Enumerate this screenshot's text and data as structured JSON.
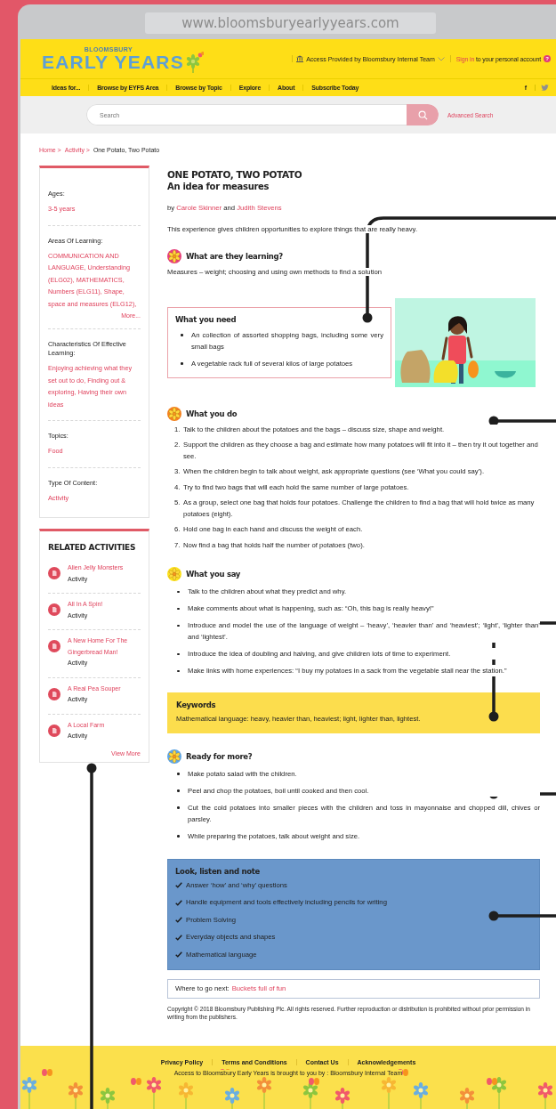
{
  "browser": {
    "url": "www.bloomsburyearlyyears.com"
  },
  "header": {
    "brand_small": "BLOOMSBURY",
    "brand": "EARLY YEARS",
    "access": "Access Provided by Bloomsbury Internal Team",
    "sign_in": "Sign in",
    "sign_in_rest": "to your personal account",
    "help": "?",
    "facebook": "f"
  },
  "nav": [
    "Ideas for...",
    "Browse by EYFS Area",
    "Browse by Topic",
    "Explore",
    "About",
    "Subscribe Today"
  ],
  "search": {
    "placeholder": "Search",
    "advanced": "Advanced Search"
  },
  "breadcrumbs": [
    {
      "label": "Home >",
      "link": true
    },
    {
      "label": "Activity >",
      "link": true
    },
    {
      "label": "One Potato, Two Potato",
      "link": false
    }
  ],
  "sidebar": {
    "facets": [
      {
        "label": "Ages:",
        "values": [
          "3-5 years"
        ]
      },
      {
        "label": "Areas Of Learning:",
        "values": [
          "COMMUNICATION AND LANGUAGE,",
          "Understanding (ELG02),",
          "MATHEMATICS,",
          "Numbers (ELG11),",
          "Shape, space and measures (ELG12),"
        ],
        "more": "More..."
      },
      {
        "label": "Characteristics Of Effective Learning:",
        "values": [
          "Enjoying achieving what they set out to do,",
          "Finding out & exploring,",
          "Having their own ideas"
        ]
      },
      {
        "label": "Topics:",
        "values": [
          "Food"
        ]
      },
      {
        "label": "Type Of Content:",
        "values": [
          "Activity"
        ]
      }
    ]
  },
  "related": {
    "title": "RELATED ACTIVITIES",
    "items": [
      {
        "title": "Alien Jelly Monsters",
        "type": "Activity"
      },
      {
        "title": "All In A Spin!",
        "type": "Activity"
      },
      {
        "title": "A New Home For The Gingerbread Man!",
        "type": "Activity"
      },
      {
        "title": "A Real Pea Souper",
        "type": "Activity"
      },
      {
        "title": "A Local Farm",
        "type": "Activity"
      }
    ],
    "view_more": "View More"
  },
  "article": {
    "title": "ONE POTATO, TWO POTATO",
    "subtitle": "An idea for measures",
    "by": "by",
    "authors": [
      "Carole Skinner",
      "Judith Stevens"
    ],
    "joiner": "and",
    "intro": "This experience gives children opportunities to explore things that are really heavy.",
    "sections": [
      {
        "kind": "text",
        "title": "What are they learning?",
        "color": "#e9407e",
        "text": "Measures – weight; choosing and using own methods to find a solution"
      },
      {
        "kind": "need",
        "title": "What you need",
        "items": [
          "An collection of assorted shopping bags, including some very small bags",
          "A vegetable rack full of several kilos of large potatoes"
        ]
      },
      {
        "kind": "steps",
        "title": "What you do",
        "color": "#f6831f",
        "items": [
          {
            "number": "1.",
            "text": "Talk to the children about the potatoes and the bags – discuss size, shape and weight."
          },
          {
            "number": "2.",
            "text": "Support the children as they choose a bag and estimate how many potatoes will fit into it – then try it out together and see."
          },
          {
            "number": "3.",
            "text": "When the children begin to talk about weight, ask appropriate questions (see ‘What you could say’)."
          },
          {
            "number": "4.",
            "text": "Try to find two bags that will each hold the same number of large potatoes."
          },
          {
            "number": "5.",
            "text": "As a group, select one bag that holds four potatoes. Challenge the children to find a bag that will hold twice as many potatoes (eight)."
          },
          {
            "number": "6.",
            "text": "Hold one bag in each hand and discuss the weight of each."
          },
          {
            "number": "7.",
            "text": "Now find a bag that holds half the number of potatoes (two)."
          }
        ]
      },
      {
        "kind": "bullets",
        "title": "What you say",
        "color": "#fde31d",
        "items": [
          "Talk to the children about what they predict and why.",
          "Make comments about what is happening, such as: “Oh, this bag is really heavy!”",
          "Introduce and model the use of the language of weight – ‘heavy’, ‘heavier than’ and ‘heaviest’; ‘light’, ‘lighter than’ and ‘lightest’.",
          "Introduce the idea of doubling and halving, and give children lots of time to experiment.",
          "Make links with home experiences: “I buy my potatoes in a sack from the vegetable stall near the station.”"
        ]
      },
      {
        "kind": "keywords",
        "title": "Keywords",
        "text": "Mathematical language: heavy, heavier than, heaviest; light, lighter than, lightest."
      },
      {
        "kind": "bullets",
        "title": "Ready for more?",
        "color": "#5fa8e8",
        "items": [
          "Make potato salad with the children.",
          "Peel and chop the potatoes, boil until cooked and then cool.",
          "Cut the cold potatoes into smaller pieces with the children and toss in mayonnaise and chopped dill, chives or parsley.",
          "While preparing the potatoes, talk about weight and size."
        ]
      },
      {
        "kind": "checklist",
        "title": "Look, listen and note",
        "items": [
          "Answer ‘how’ and ‘why’ questions",
          "Handle equipment and tools effectively including pencils for writing",
          "Problem Solving",
          "Everyday objects and shapes",
          "Mathematical language"
        ]
      },
      {
        "kind": "next",
        "label": "Where to go next:",
        "link": "Buckets full of fun"
      }
    ],
    "copyright": "Copyright © 2018 Bloomsbury Publishing Plc. All rights reserved. Further reproduction or distribution is prohibited without prior permission in writing from the publishers."
  },
  "footer": {
    "links": [
      "Privacy Policy",
      "Terms and Conditions",
      "Contact Us",
      "Acknowledgements"
    ],
    "note": "Access to Bloomsbury Early Years is brought to you by : Bloomsbury Internal Team"
  }
}
